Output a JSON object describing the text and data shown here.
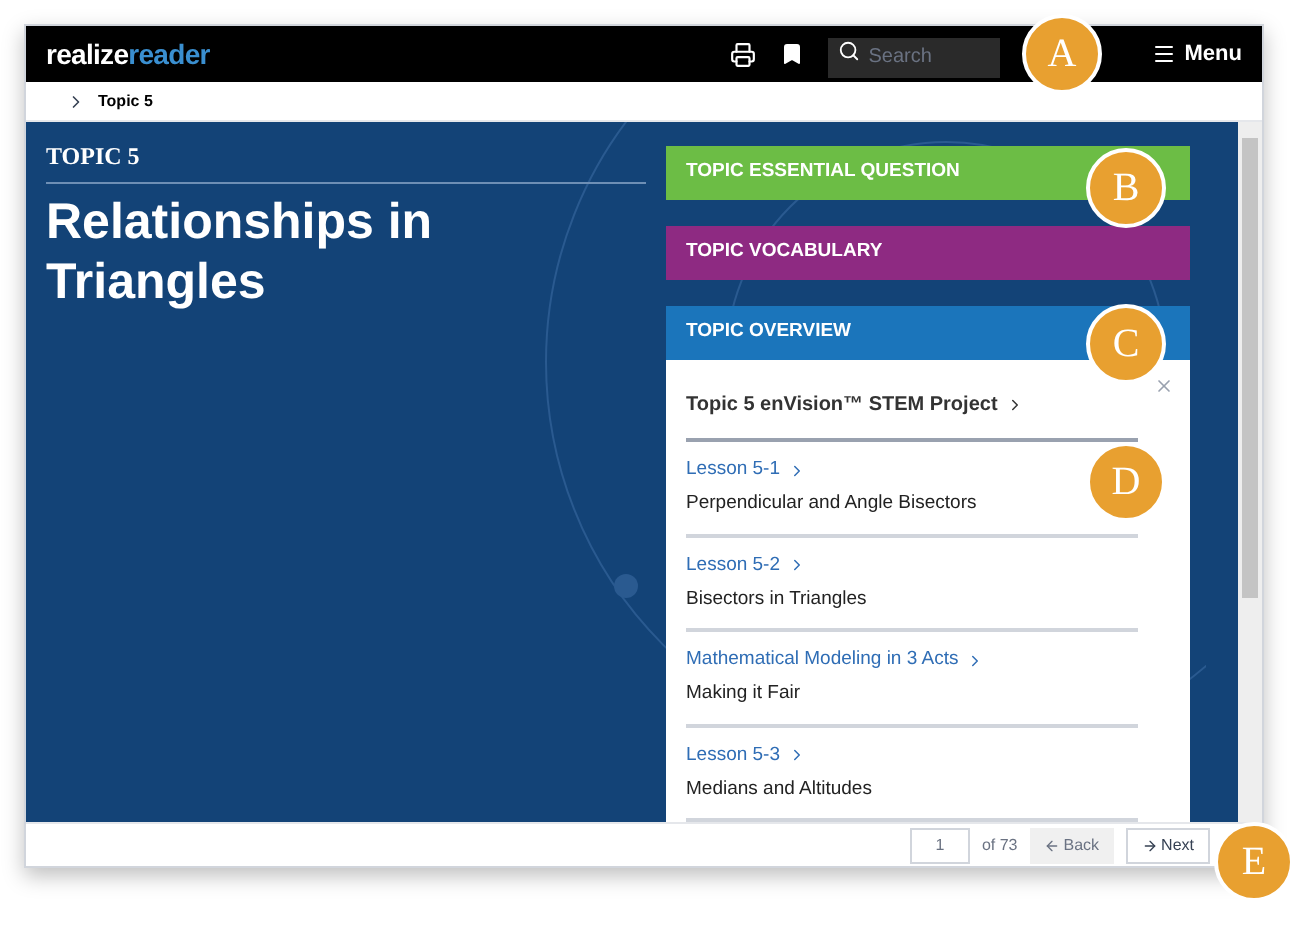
{
  "header": {
    "logo": {
      "part_1": "realize",
      "part_2": "reader"
    },
    "search": {
      "placeholder": "Search"
    },
    "menu": "Menu"
  },
  "breadcrumb": "Topic 5",
  "topic": {
    "label": "TOPIC 5",
    "title": "Relationships in Triangles"
  },
  "sections": [
    {
      "label": "TOPIC ESSENTIAL QUESTION",
      "color": "#6cbd45"
    },
    {
      "label": "TOPIC VOCABULARY",
      "color": "#8e2a82"
    },
    {
      "label": "TOPIC OVERVIEW",
      "color": "#1b75bb"
    }
  ],
  "overview": [
    {
      "kind": "project",
      "link": "Topic 5 enVision™ STEM Project"
    },
    {
      "kind": "lesson",
      "link": "Lesson 5-1",
      "title": "Perpendicular and Angle Bisectors"
    },
    {
      "kind": "lesson",
      "link": "Lesson 5-2",
      "title": "Bisectors in Triangles"
    },
    {
      "kind": "lesson",
      "link": "Mathematical Modeling in 3 Acts",
      "title": "Making it Fair"
    },
    {
      "kind": "lesson",
      "link": "Lesson 5-3",
      "title": "Medians and Altitudes"
    }
  ],
  "pager": {
    "page": "1",
    "total": "of 73",
    "back": {
      "label": "Back",
      "disabled": true
    },
    "next": {
      "label": "Next",
      "disabled": false
    }
  },
  "callouts": [
    "A",
    "B",
    "C",
    "D",
    "E"
  ]
}
